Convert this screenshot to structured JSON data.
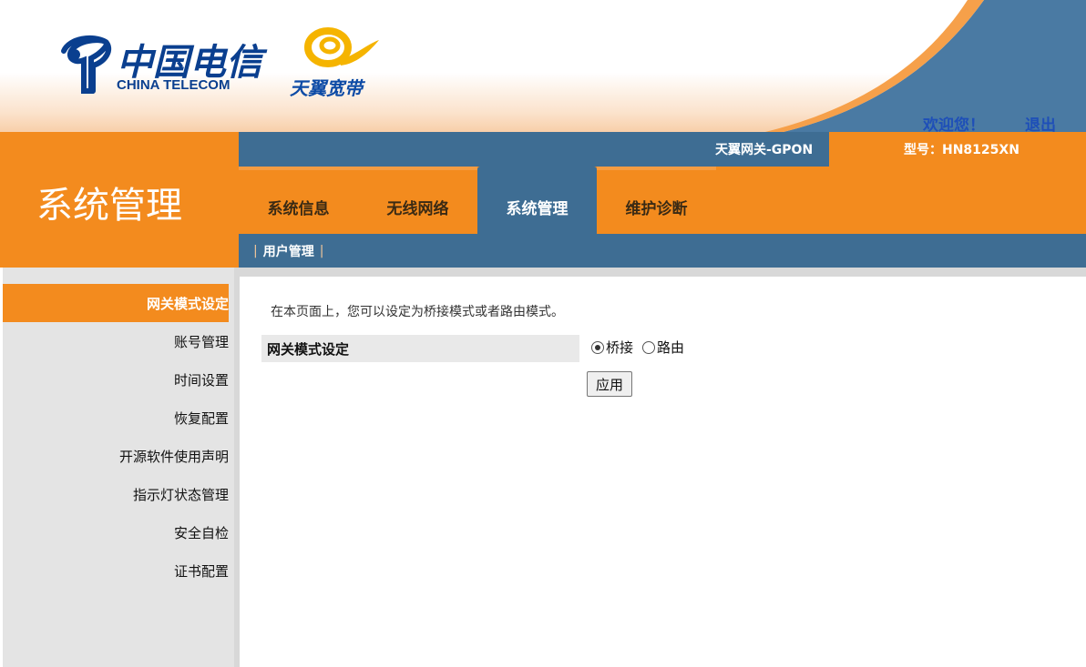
{
  "header": {
    "logo_cn": "中国电信",
    "logo_en": "CHINA TELECOM",
    "brand_text": "天翼宽带",
    "welcome": "欢迎您！",
    "logout": "退出"
  },
  "band": {
    "section_title": "系统管理",
    "gateway_name": "天翼网关-GPON",
    "model": "型号：HN8125XN"
  },
  "tabs": [
    {
      "label": "系统信息",
      "active": false
    },
    {
      "label": "无线网络",
      "active": false
    },
    {
      "label": "系统管理",
      "active": true
    },
    {
      "label": "维护诊断",
      "active": false
    }
  ],
  "subnav": {
    "items": [
      "用户管理"
    ]
  },
  "sidebar": {
    "items": [
      {
        "label": "网关模式设定",
        "active": true
      },
      {
        "label": "账号管理",
        "active": false
      },
      {
        "label": "时间设置",
        "active": false
      },
      {
        "label": "恢复配置",
        "active": false
      },
      {
        "label": "开源软件使用声明",
        "active": false
      },
      {
        "label": "指示灯状态管理",
        "active": false
      },
      {
        "label": "安全自检",
        "active": false
      },
      {
        "label": "证书配置",
        "active": false
      }
    ]
  },
  "main": {
    "intro": "在本页面上，您可以设定为桥接模式或者路由模式。",
    "field_label": "网关模式设定",
    "options": [
      {
        "label": "桥接",
        "checked": true
      },
      {
        "label": "路由",
        "checked": false
      }
    ],
    "apply_label": "应用"
  },
  "colors": {
    "orange": "#f38b1e",
    "steel_blue": "#3e6d93",
    "link_blue": "#1e4fb8"
  }
}
